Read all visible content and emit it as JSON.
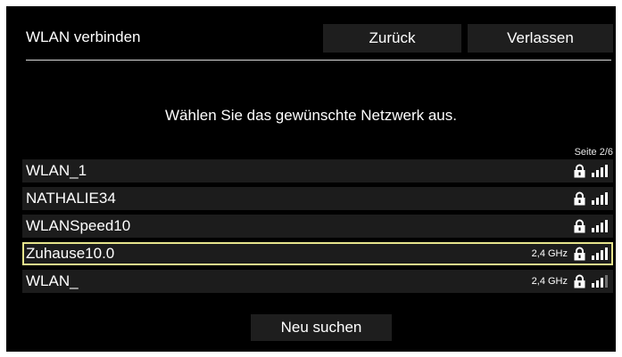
{
  "header": {
    "title": "WLAN verbinden",
    "back_label": "Zurück",
    "exit_label": "Verlassen"
  },
  "prompt": "Wählen Sie das gewünschte Netzwerk aus.",
  "page_indicator": "Seite 2/6",
  "networks": [
    {
      "name": "WLAN_1",
      "band": "",
      "secured": true,
      "signal_bars": 4,
      "selected": false
    },
    {
      "name": "NATHALIE34",
      "band": "",
      "secured": true,
      "signal_bars": 4,
      "selected": false
    },
    {
      "name": "WLANSpeed10",
      "band": "",
      "secured": true,
      "signal_bars": 4,
      "selected": false
    },
    {
      "name": "Zuhause10.0",
      "band": "2,4 GHz",
      "secured": true,
      "signal_bars": 4,
      "selected": true
    },
    {
      "name": "WLAN_",
      "band": "2,4 GHz",
      "secured": true,
      "signal_bars": 3,
      "selected": false
    }
  ],
  "rescan_label": "Neu suchen",
  "colors": {
    "background": "#000000",
    "row_background": "#1c1c1c",
    "button_background": "#1e1e1e",
    "selection_border": "#e7e58c",
    "text": "#ffffff"
  },
  "icons": {
    "lock": "lock-icon",
    "signal": "wifi-signal-icon"
  }
}
